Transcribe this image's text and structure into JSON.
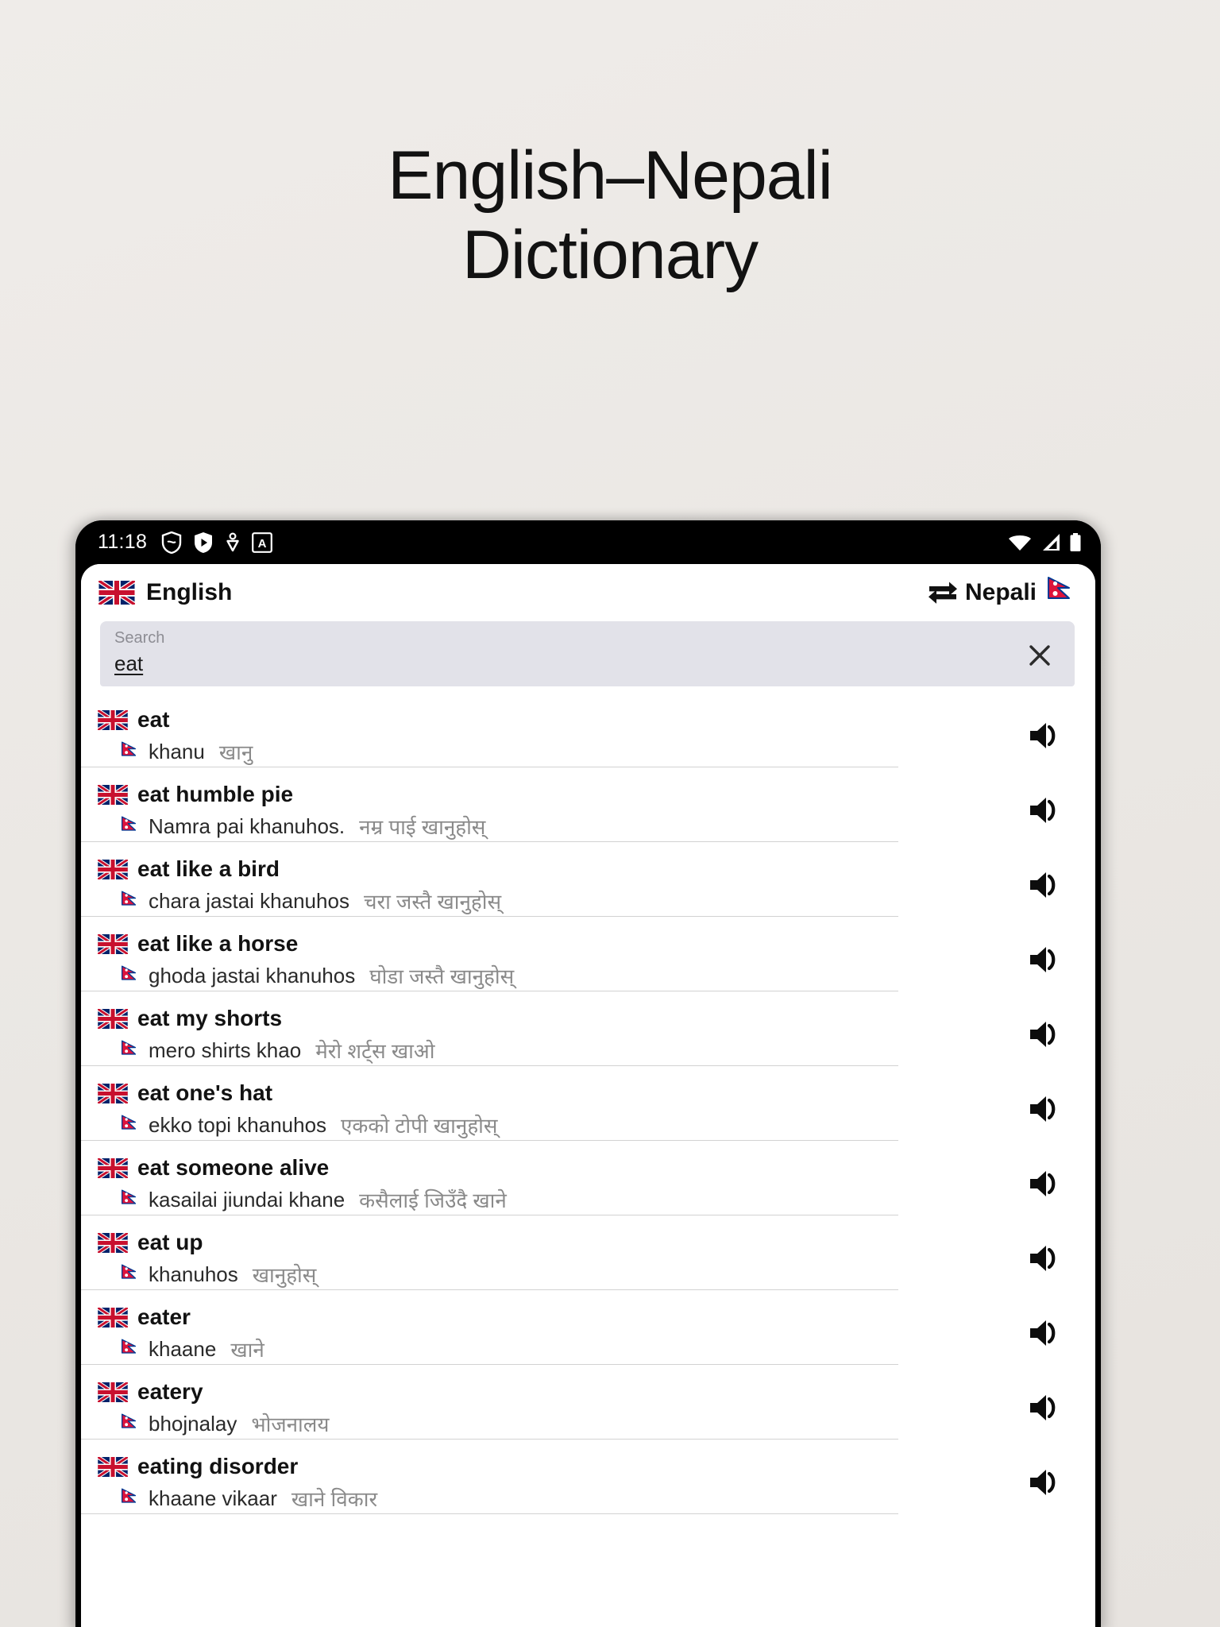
{
  "hero": {
    "line1": "English–Nepali",
    "line2": "Dictionary"
  },
  "statusbar": {
    "time": "11:18",
    "left_icons": [
      "shield-icon",
      "play-badge-icon",
      "heartbeat-icon",
      "a-badge-icon"
    ],
    "right_icons": [
      "wifi-icon",
      "cellular-signal-icon",
      "battery-icon"
    ]
  },
  "header": {
    "source_language": "English",
    "source_flag": "uk-flag-icon",
    "swap_icon": "swap-arrows-icon",
    "target_language": "Nepali",
    "target_flag": "nepal-flag-icon"
  },
  "search": {
    "placeholder": "Search",
    "value": "eat",
    "clear_icon": "close-icon"
  },
  "results": [
    {
      "term": "eat",
      "romanized": "khanu",
      "devanagari": "खानु",
      "speaker_icon": "speaker-icon"
    },
    {
      "term": "eat humble pie",
      "romanized": "Namra pai khanuhos.",
      "devanagari": "नम्र पाई खानुहोस्",
      "speaker_icon": "speaker-icon"
    },
    {
      "term": "eat like a bird",
      "romanized": "chara jastai khanuhos",
      "devanagari": "चरा जस्तै खानुहोस्",
      "speaker_icon": "speaker-icon"
    },
    {
      "term": "eat like a horse",
      "romanized": "ghoda jastai khanuhos",
      "devanagari": "घोडा जस्तै खानुहोस्",
      "speaker_icon": "speaker-icon"
    },
    {
      "term": "eat my shorts",
      "romanized": "mero shirts khao",
      "devanagari": "मेरो शर्ट्स खाओ",
      "speaker_icon": "speaker-icon"
    },
    {
      "term": "eat one's hat",
      "romanized": "ekko topi khanuhos",
      "devanagari": "एकको टोपी खानुहोस्",
      "speaker_icon": "speaker-icon"
    },
    {
      "term": "eat someone alive",
      "romanized": "kasailai jiundai khane",
      "devanagari": "कसैलाई जिउँदै खाने",
      "speaker_icon": "speaker-icon"
    },
    {
      "term": "eat up",
      "romanized": "khanuhos",
      "devanagari": "खानुहोस्",
      "speaker_icon": "speaker-icon"
    },
    {
      "term": "eater",
      "romanized": "khaane",
      "devanagari": "खाने",
      "speaker_icon": "speaker-icon"
    },
    {
      "term": "eatery",
      "romanized": "bhojnalay",
      "devanagari": "भोजनालय",
      "speaker_icon": "speaker-icon"
    },
    {
      "term": "eating disorder",
      "romanized": "khaane vikaar",
      "devanagari": "खाने विकार",
      "speaker_icon": "speaker-icon"
    }
  ],
  "colors": {
    "page_background": "#ece9e6",
    "search_field": "#e2e2e9",
    "devanagari_text": "#8a8a8a",
    "uk_flag_red": "#c8102e",
    "uk_flag_blue": "#012169",
    "nepal_flag_crimson": "#dc143c",
    "nepal_flag_blue": "#003893"
  }
}
